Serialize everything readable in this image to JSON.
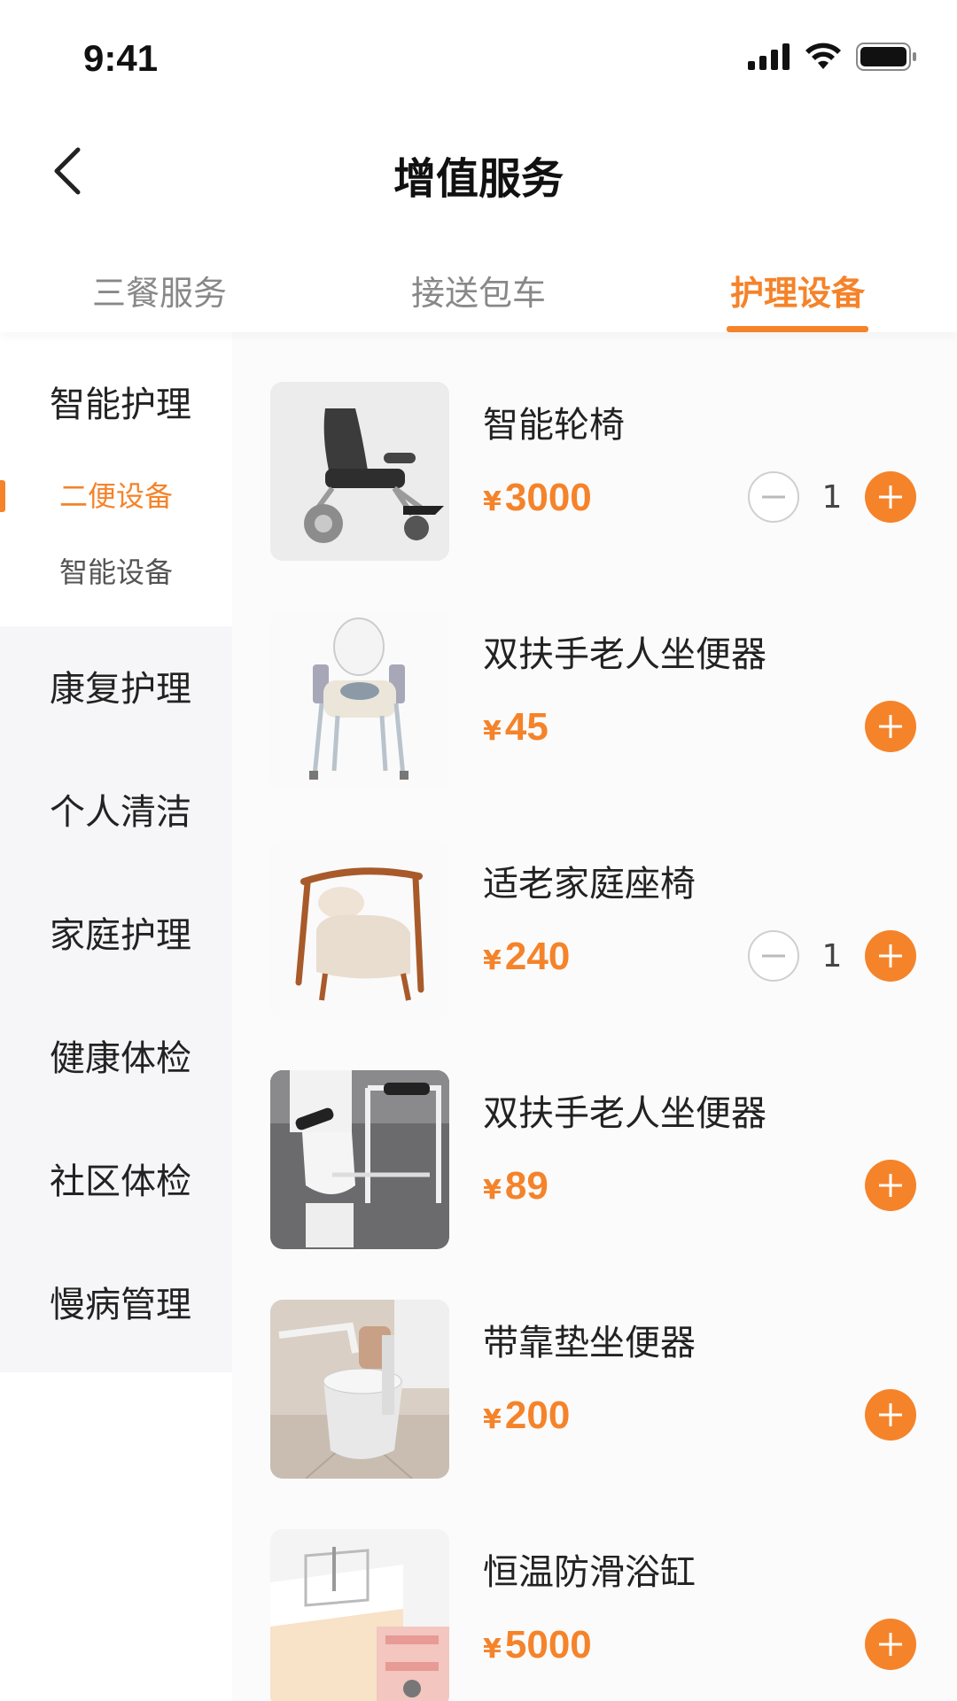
{
  "status_bar": {
    "time": "9:41"
  },
  "header": {
    "title": "增值服务"
  },
  "tabs": [
    {
      "label": "三餐服务",
      "active": false
    },
    {
      "label": "接送包车",
      "active": false
    },
    {
      "label": "护理设备",
      "active": true
    }
  ],
  "sidebar": {
    "group_title": "智能护理",
    "sub_items": [
      {
        "label": "二便设备",
        "active": true
      },
      {
        "label": "智能设备",
        "active": false
      }
    ],
    "items": [
      {
        "label": "康复护理"
      },
      {
        "label": "个人清洁"
      },
      {
        "label": "家庭护理"
      },
      {
        "label": "健康体检"
      },
      {
        "label": "社区体检"
      },
      {
        "label": "慢病管理"
      }
    ]
  },
  "currency_symbol": "¥",
  "products": [
    {
      "name": "智能轮椅",
      "price": "3000",
      "quantity": "1",
      "image_icon": "wheelchair-image"
    },
    {
      "name": "双扶手老人坐便器",
      "price": "45",
      "quantity": null,
      "image_icon": "commode-chair-image"
    },
    {
      "name": "适老家庭座椅",
      "price": "240",
      "quantity": "1",
      "image_icon": "armchair-image"
    },
    {
      "name": "双扶手老人坐便器",
      "price": "89",
      "quantity": null,
      "image_icon": "toilet-frame-image"
    },
    {
      "name": "带靠垫坐便器",
      "price": "200",
      "quantity": null,
      "image_icon": "cushioned-toilet-image"
    },
    {
      "name": "恒温防滑浴缸",
      "price": "5000",
      "quantity": null,
      "image_icon": "bathtub-image"
    }
  ],
  "colors": {
    "accent": "#f5832a",
    "side_gray": "#f6f5f7"
  }
}
